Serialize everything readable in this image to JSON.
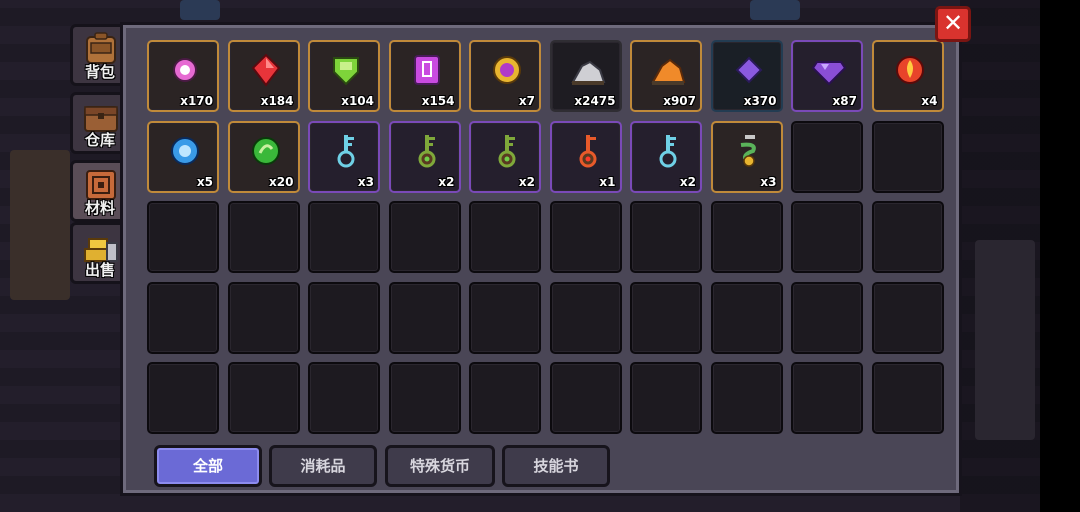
{
  "side_tabs": [
    {
      "label": "背包",
      "icon": "backpack-icon",
      "active": false
    },
    {
      "label": "仓库",
      "icon": "warehouse-chest-icon",
      "active": false
    },
    {
      "label": "材料",
      "icon": "materials-book-icon",
      "active": true
    },
    {
      "label": "出售",
      "icon": "gold-coins-icon",
      "active": false
    }
  ],
  "close_label": "✕",
  "items": [
    {
      "icon": "pink-orb-gem-icon",
      "count": "x170",
      "rarity": "orange",
      "color": "#e66ad2"
    },
    {
      "icon": "red-ruby-icon",
      "count": "x184",
      "rarity": "orange",
      "color": "#e8343a"
    },
    {
      "icon": "green-emerald-icon",
      "count": "x104",
      "rarity": "orange",
      "color": "#7ed43a"
    },
    {
      "icon": "purple-crystal-cube-icon",
      "count": "x154",
      "rarity": "orange",
      "color": "#c94be0"
    },
    {
      "icon": "purple-coin-icon",
      "count": "x7",
      "rarity": "orange",
      "color": "#e8b530"
    },
    {
      "icon": "silver-ore-pile-icon",
      "count": "x2475",
      "rarity": "dark",
      "color": "#cfcfd4"
    },
    {
      "icon": "orange-ore-pile-icon",
      "count": "x907",
      "rarity": "orange",
      "color": "#f08a2a"
    },
    {
      "icon": "violet-crystal-icon",
      "count": "x370",
      "rarity": "blue",
      "color": "#8a5ae0"
    },
    {
      "icon": "purple-diamond-icon",
      "count": "x87",
      "rarity": "purple",
      "color": "#8a4ed6"
    },
    {
      "icon": "fire-orb-icon",
      "count": "x4",
      "rarity": "orange",
      "color": "#e8442a"
    },
    {
      "icon": "blue-orb-icon",
      "count": "x5",
      "rarity": "orange",
      "color": "#3a9be8"
    },
    {
      "icon": "green-orb-icon",
      "count": "x20",
      "rarity": "orange",
      "color": "#3ab83a"
    },
    {
      "icon": "cyan-key-icon",
      "count": "x3",
      "rarity": "purple",
      "color": "#6fd0e6"
    },
    {
      "icon": "green-key-icon",
      "count": "x2",
      "rarity": "purple",
      "color": "#7fa83a"
    },
    {
      "icon": "green-key-icon",
      "count": "x2",
      "rarity": "purple",
      "color": "#7fa83a"
    },
    {
      "icon": "red-key-icon",
      "count": "x1",
      "rarity": "purple",
      "color": "#e85a2a"
    },
    {
      "icon": "cyan-key-icon",
      "count": "x2",
      "rarity": "purple",
      "color": "#6fd0e6"
    },
    {
      "icon": "green-serpent-amulet-icon",
      "count": "x3",
      "rarity": "orange",
      "color": "#5ab35a"
    }
  ],
  "empty_slots": 32,
  "filter_tabs": [
    {
      "label": "全部",
      "active": true
    },
    {
      "label": "消耗品",
      "active": false
    },
    {
      "label": "特殊货币",
      "active": false
    },
    {
      "label": "技能书",
      "active": false
    }
  ]
}
